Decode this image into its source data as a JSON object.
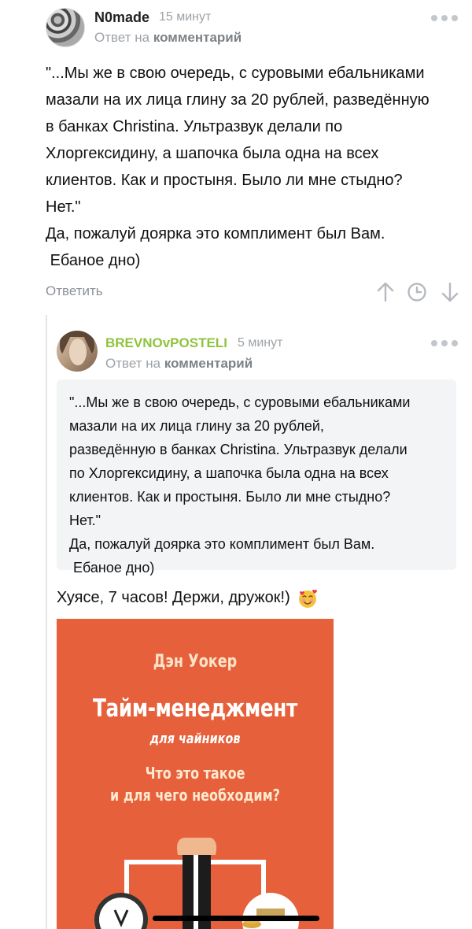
{
  "comment1": {
    "author": "N0made",
    "time": "15 минут",
    "reply_to_prefix": "Ответ на",
    "reply_to_link": "комментарий",
    "text": "\"...Мы же в свою очередь, с суровыми ебальниками\nмазали на их лица глину за 20 рублей, разведённую\nв банках Christina. Ультразвук делали по\nХлоргексидину, а шапочка была одна на всех\nклиентов. Как и простыня. Было ли мне стыдно?\nНет.\"\nДа, пожалуй доярка это комплимент был Вам.\n Ебаное дно)",
    "reply_label": "Ответить",
    "icons": [
      "more-icon",
      "arrow-up-icon",
      "clock-icon",
      "arrow-down-icon"
    ]
  },
  "comment2": {
    "author": "BREVNOvPOSTELI",
    "time": "5 минут",
    "reply_to_prefix": "Ответ на",
    "reply_to_link": "комментарий",
    "quote": "\"...Мы же в свою очередь, с суровыми ебальниками\nмазали на их лица глину за 20 рублей,\nразведённую в банках Christina. Ультразвук делали\nпо Хлоргексидину, а шапочка была одна на всех\nклиентов. Как и простыня. Было ли мне стыдно?\nНет.\"\nДа, пожалуй доярка это комплимент был Вам.\n Ебаное дно)",
    "text": "Хуясе, 7 часов! Держи, дружок!)",
    "emoji": "smiling-face-with-hearts",
    "colors": {
      "author": "#8fc33e"
    }
  },
  "book": {
    "author": "Дэн Уокер",
    "title": "Тайм-менеджмент",
    "subtitle": "для чайников",
    "question": "Что это такое\nи для чего необходим?",
    "colors": {
      "background": "#e5603b"
    }
  },
  "colors": {
    "meta": "#9ea3a8",
    "accent": "#8fc33e"
  }
}
